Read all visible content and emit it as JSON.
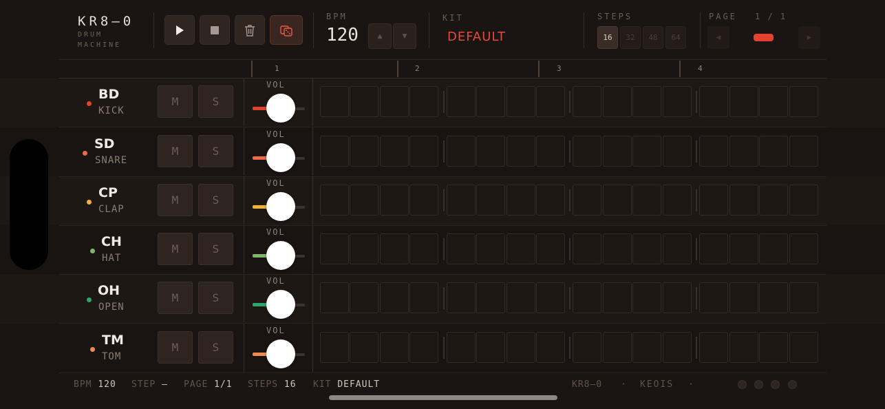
{
  "app": {
    "title": "KR8—0",
    "subtitle_line1": "DRUM",
    "subtitle_line2": "MACHINE"
  },
  "transport": {
    "play_icon": "play-icon",
    "stop_icon": "stop-icon",
    "clear_icon": "trash-icon",
    "random_icon": "dice-icon"
  },
  "bpm": {
    "label": "BPM",
    "value": "120",
    "up": "▲",
    "down": "▼"
  },
  "kit": {
    "label": "KIT",
    "value": "DEFAULT"
  },
  "steps": {
    "label": "STEPS",
    "options": [
      "16",
      "32",
      "48",
      "64"
    ],
    "selected": "16"
  },
  "page": {
    "label": "PAGE",
    "value": "1 / 1",
    "prev": "◀",
    "next": "▶"
  },
  "ruler": {
    "bars": [
      "1",
      "2",
      "3",
      "4"
    ]
  },
  "vol_label": "VOL",
  "mute_label": "M",
  "solo_label": "S",
  "tracks": [
    {
      "name": "BD",
      "sub": "KICK",
      "color": "#e3422f",
      "volume": 0.4
    },
    {
      "name": "SD",
      "sub": "SNARE",
      "color": "#ec6a45",
      "volume": 0.4
    },
    {
      "name": "CP",
      "sub": "CLAP",
      "color": "#f1b13a",
      "volume": 0.4
    },
    {
      "name": "CH",
      "sub": "HAT",
      "color": "#7fb86a",
      "volume": 0.4
    },
    {
      "name": "OH",
      "sub": "OPEN",
      "color": "#2ea56a",
      "volume": 0.4
    },
    {
      "name": "TM",
      "sub": "TOM",
      "color": "#f08a50",
      "volume": 0.4
    }
  ],
  "status": {
    "bpm_label": "BPM",
    "bpm_value": "120",
    "step_label": "STEP",
    "step_value": "—",
    "page_label": "PAGE",
    "page_value": "1/1",
    "steps_label": "STEPS",
    "steps_value": "16",
    "kit_label": "KIT",
    "kit_value": "DEFAULT",
    "brand": "KR8—0",
    "sep1": "·",
    "author": "KEOIS",
    "sep2": "·"
  }
}
